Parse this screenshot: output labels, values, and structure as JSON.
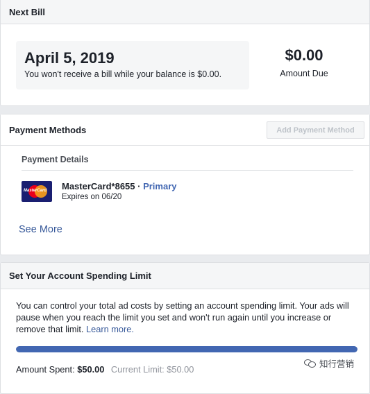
{
  "next_bill": {
    "title": "Next Bill",
    "date": "April 5, 2019",
    "note": "You won't receive a bill while your balance is $0.00.",
    "amount": "$0.00",
    "amount_label": "Amount Due"
  },
  "payment_methods": {
    "title": "Payment Methods",
    "add_button": "Add Payment Method",
    "details_title": "Payment Details",
    "card": {
      "logo_text": "MasterCard",
      "name": "MasterCard*8655",
      "separator": " · ",
      "primary_label": "Primary",
      "expiry": "Expires on 06/20"
    },
    "see_more": "See More"
  },
  "spending_limit": {
    "title": "Set Your Account Spending Limit",
    "description": "You can control your total ad costs by setting an account spending limit. Your ads will pause when you reach the limit you set and won't run again until you increase or remove that limit. ",
    "learn_more": "Learn more.",
    "progress_percent": 100,
    "spent_label": "Amount Spent:",
    "spent_value": "$50.00",
    "current_limit": "Current Limit: $50.00"
  },
  "watermark": {
    "text": "知行营销",
    "icon": "wechat-icon"
  },
  "colors": {
    "accent": "#4267b2",
    "link": "#365899",
    "page_bg": "#e9ebee"
  }
}
